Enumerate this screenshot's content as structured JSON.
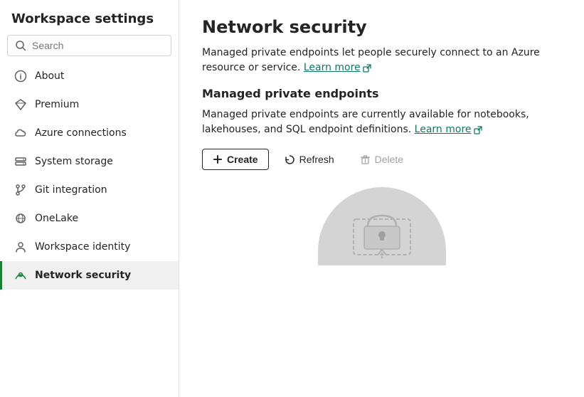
{
  "sidebar": {
    "title": "Workspace settings",
    "search": {
      "placeholder": "Search"
    },
    "items": [
      {
        "id": "about",
        "label": "About",
        "icon": "info-icon"
      },
      {
        "id": "premium",
        "label": "Premium",
        "icon": "diamond-icon"
      },
      {
        "id": "azure-connections",
        "label": "Azure connections",
        "icon": "cloud-icon"
      },
      {
        "id": "system-storage",
        "label": "System storage",
        "icon": "storage-icon"
      },
      {
        "id": "git-integration",
        "label": "Git integration",
        "icon": "git-icon"
      },
      {
        "id": "onelake",
        "label": "OneLake",
        "icon": "onelake-icon"
      },
      {
        "id": "workspace-identity",
        "label": "Workspace identity",
        "icon": "identity-icon"
      },
      {
        "id": "network-security",
        "label": "Network security",
        "icon": "network-icon",
        "active": true
      }
    ]
  },
  "main": {
    "page_title": "Network security",
    "description1": "Managed private endpoints let people securely connect to an Azure resource or service.",
    "learn_more_1": "Learn more",
    "section_title": "Managed private endpoints",
    "description2": "Managed private endpoints are currently available for notebooks, lakehouses, and SQL endpoint definitions.",
    "learn_more_2": "Learn more",
    "actions": {
      "create": "Create",
      "refresh": "Refresh",
      "delete": "Delete"
    }
  }
}
